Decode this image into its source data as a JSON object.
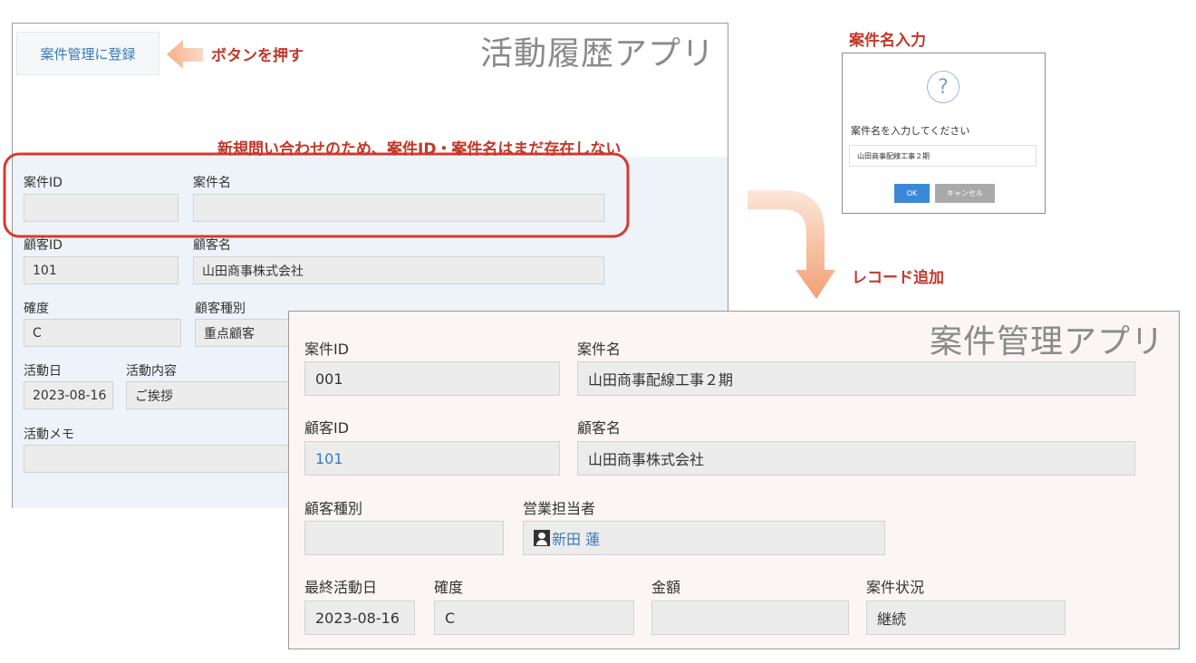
{
  "activity_app": {
    "title": "活動履歴アプリ",
    "register_button": "案件管理に登録",
    "fields": {
      "project_id_label": "案件ID",
      "project_id_value": "",
      "project_name_label": "案件名",
      "project_name_value": "",
      "customer_id_label": "顧客ID",
      "customer_id_value": "101",
      "customer_name_label": "顧客名",
      "customer_name_value": "山田商事株式会社",
      "certainty_label": "確度",
      "certainty_value": "C",
      "customer_type_label": "顧客種別",
      "customer_type_value": "重点顧客",
      "activity_date_label": "活動日",
      "activity_date_value": "2023-08-16",
      "activity_content_label": "活動内容",
      "activity_content_value": "ご挨拶",
      "activity_memo_label": "活動メモ",
      "activity_memo_value": ""
    }
  },
  "annotations": {
    "press_button": "ボタンを押す",
    "new_inquiry_note": "新規問い合わせのため、案件ID・案件名はまだ存在しない",
    "input_project_name": "案件名入力",
    "add_record": "レコード追加"
  },
  "dialog": {
    "prompt": "案件名を入力してください",
    "input_value": "山田商事配線工事２期",
    "ok_label": "OK",
    "cancel_label": "キャンセル",
    "icon": "question-icon"
  },
  "project_app": {
    "title": "案件管理アプリ",
    "fields": {
      "project_id_label": "案件ID",
      "project_id_value": "001",
      "project_name_label": "案件名",
      "project_name_value": "山田商事配線工事２期",
      "customer_id_label": "顧客ID",
      "customer_id_value": "101",
      "customer_name_label": "顧客名",
      "customer_name_value": "山田商事株式会社",
      "customer_type_label": "顧客種別",
      "customer_type_value": "",
      "sales_rep_label": "営業担当者",
      "sales_rep_value": "新田 蓮",
      "last_activity_label": "最終活動日",
      "last_activity_value": "2023-08-16",
      "certainty_label": "確度",
      "certainty_value": "C",
      "amount_label": "金額",
      "amount_value": "",
      "status_label": "案件状況",
      "status_value": "継続"
    }
  },
  "colors": {
    "annotation_red": "#c0392b",
    "highlight_red": "#d9382f",
    "arrow_orange": "#f0a37b",
    "link_blue": "#3a7ab8",
    "ok_blue": "#3b88d8"
  }
}
